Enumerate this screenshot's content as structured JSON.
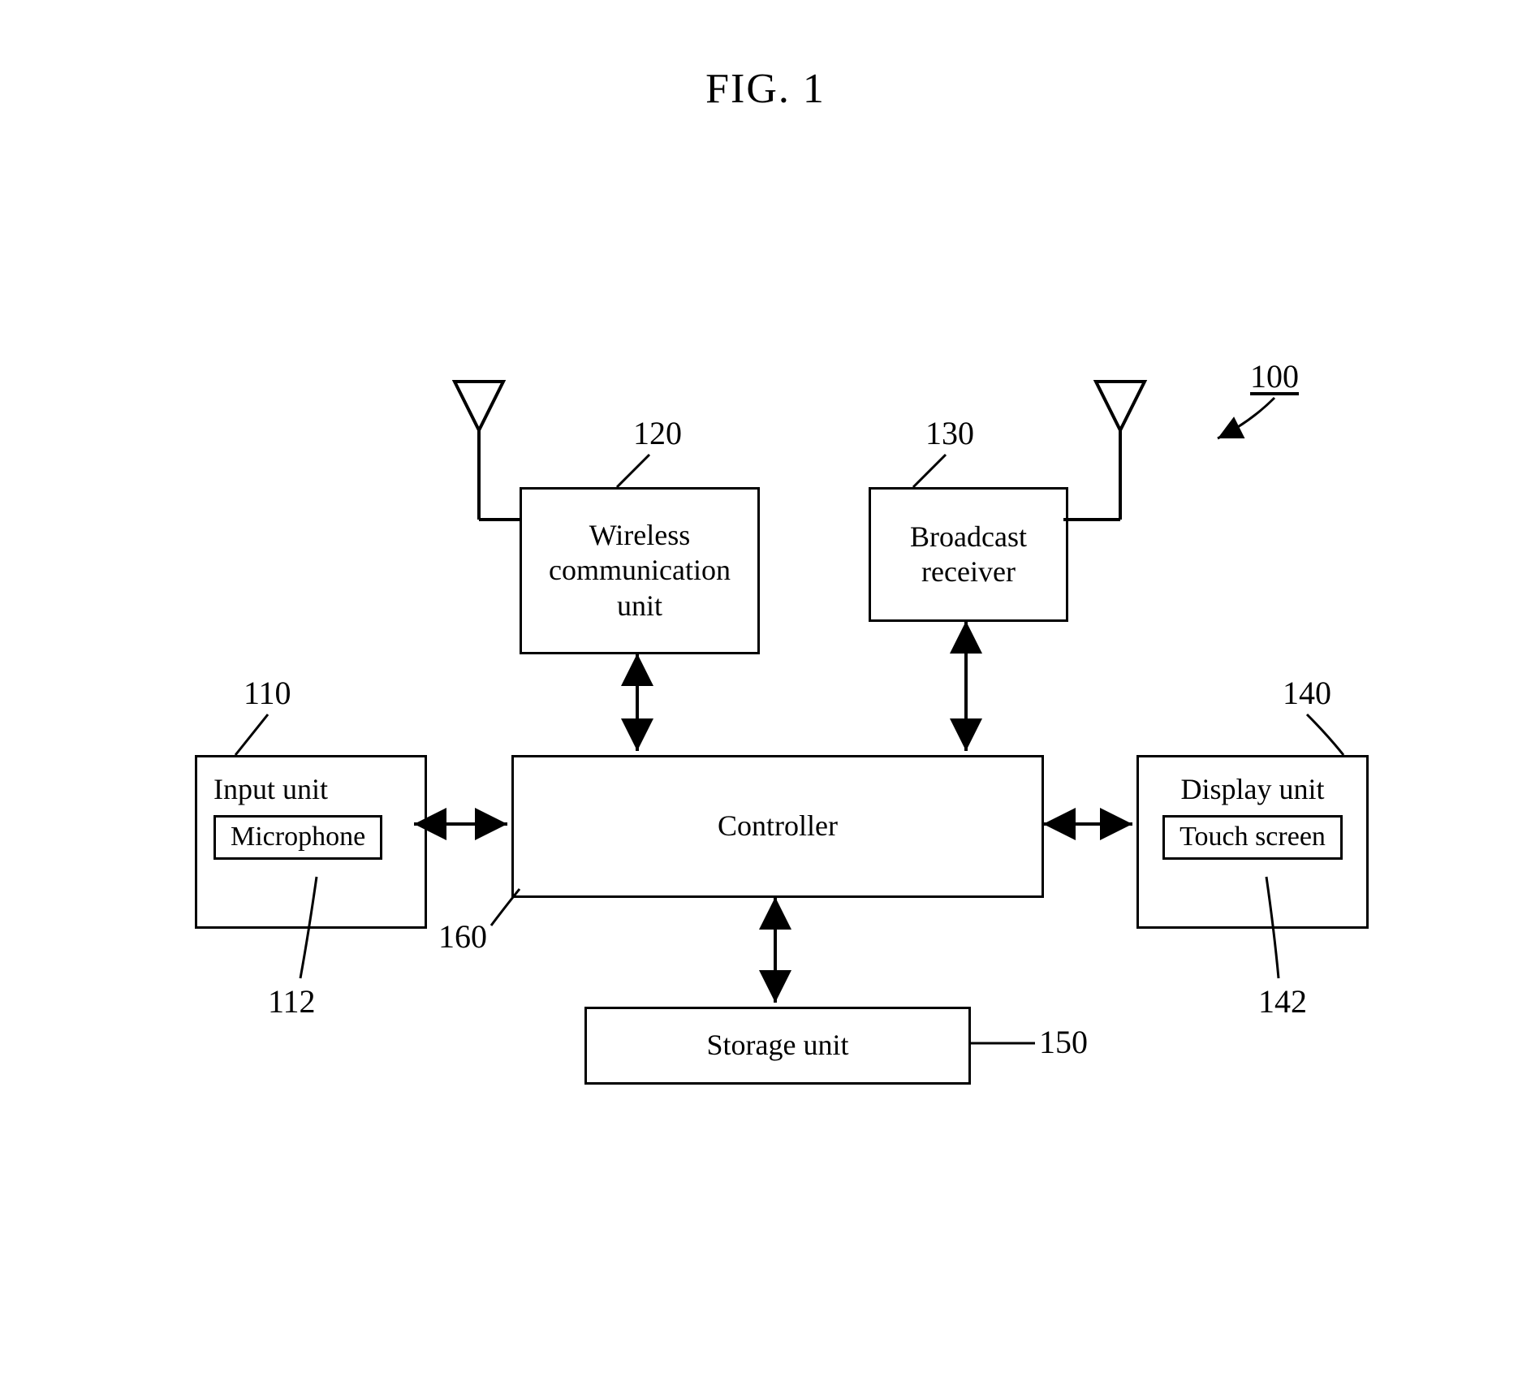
{
  "figure_title": "FIG. 1",
  "refs": {
    "system": "100",
    "input_unit": "110",
    "microphone": "112",
    "wireless": "120",
    "broadcast": "130",
    "display_unit": "140",
    "touch_screen": "142",
    "storage": "150",
    "controller": "160"
  },
  "blocks": {
    "input_unit": "Input unit",
    "microphone": "Microphone",
    "wireless_l1": "Wireless",
    "wireless_l2": "communication",
    "wireless_l3": "unit",
    "broadcast_l1": "Broadcast",
    "broadcast_l2": "receiver",
    "controller": "Controller",
    "display_unit": "Display unit",
    "touch_screen": "Touch screen",
    "storage": "Storage unit"
  }
}
